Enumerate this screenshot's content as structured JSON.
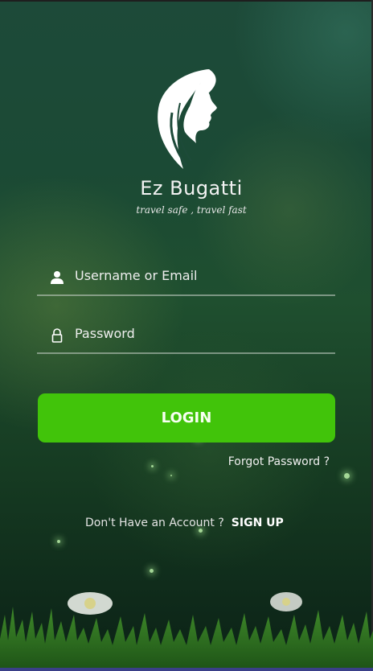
{
  "app": {
    "title": "Ez Bugatti",
    "tagline": "travel safe , travel fast",
    "logo_icon": "woman-profile-logo-icon"
  },
  "form": {
    "username_placeholder": "Username or Email",
    "username_icon": "user-icon",
    "password_placeholder": "Password",
    "password_icon": "lock-icon",
    "login_label": "LOGIN",
    "forgot_label": "Forgot Password ?"
  },
  "signup": {
    "prompt": "Don't Have an Account ?",
    "link_label": "SIGN UP"
  },
  "colors": {
    "accent": "#41c40a",
    "background": "#1b4a35"
  }
}
